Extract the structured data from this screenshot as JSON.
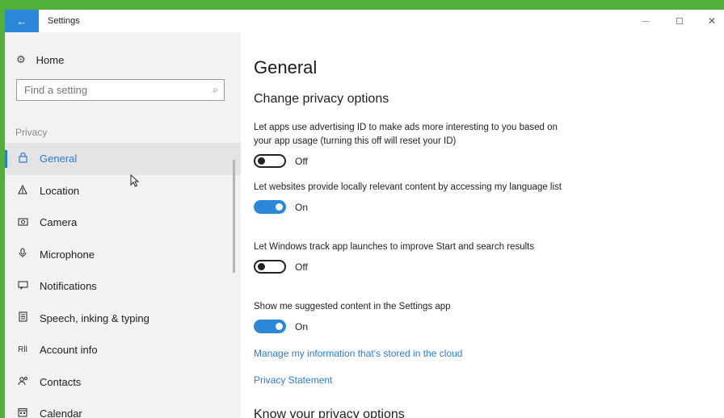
{
  "window": {
    "title": "Settings",
    "back_glyph": "←",
    "minimize_glyph": "—",
    "maximize_glyph": "☐",
    "close_glyph": "✕"
  },
  "sidebar": {
    "home_label": "Home",
    "home_icon": "⚙",
    "search_placeholder": "Find a setting",
    "search_icon": "⌕",
    "section_label": "Privacy",
    "items": [
      {
        "label": "General",
        "icon": "🔒",
        "icon_name": "lock-icon",
        "active": true
      },
      {
        "label": "Location",
        "icon": "⚠",
        "icon_name": "location-icon"
      },
      {
        "label": "Camera",
        "icon": "📷",
        "icon_name": "camera-icon"
      },
      {
        "label": "Microphone",
        "icon": "🎙",
        "icon_name": "microphone-icon"
      },
      {
        "label": "Notifications",
        "icon": "▭",
        "icon_name": "notifications-icon"
      },
      {
        "label": "Speech, inking & typing",
        "icon": "▤",
        "icon_name": "speech-icon"
      },
      {
        "label": "Account info",
        "icon": "Rll",
        "icon_name": "account-info-icon"
      },
      {
        "label": "Contacts",
        "icon": "ጵ",
        "icon_name": "contacts-icon"
      },
      {
        "label": "Calendar",
        "icon": "▦",
        "icon_name": "calendar-icon"
      }
    ]
  },
  "main": {
    "title": "General",
    "section_heading": "Change privacy options",
    "settings": [
      {
        "description": "Let apps use advertising ID to make ads more interesting to you based on your app usage (turning this off will reset your ID)",
        "state": "Off"
      },
      {
        "description": "Let websites provide locally relevant content by accessing my language list",
        "state": "On"
      },
      {
        "description": "Let Windows track app launches to improve Start and search results",
        "state": "Off"
      },
      {
        "description": "Show me suggested content in the Settings app",
        "state": "On"
      }
    ],
    "links": [
      "Manage my information that's stored in the cloud",
      "Privacy Statement"
    ],
    "section_heading_2": "Know your privacy options"
  },
  "colors": {
    "accent": "#2b88d8",
    "desktop_border": "#52b03a",
    "sidebar_bg": "#f2f2f2"
  }
}
